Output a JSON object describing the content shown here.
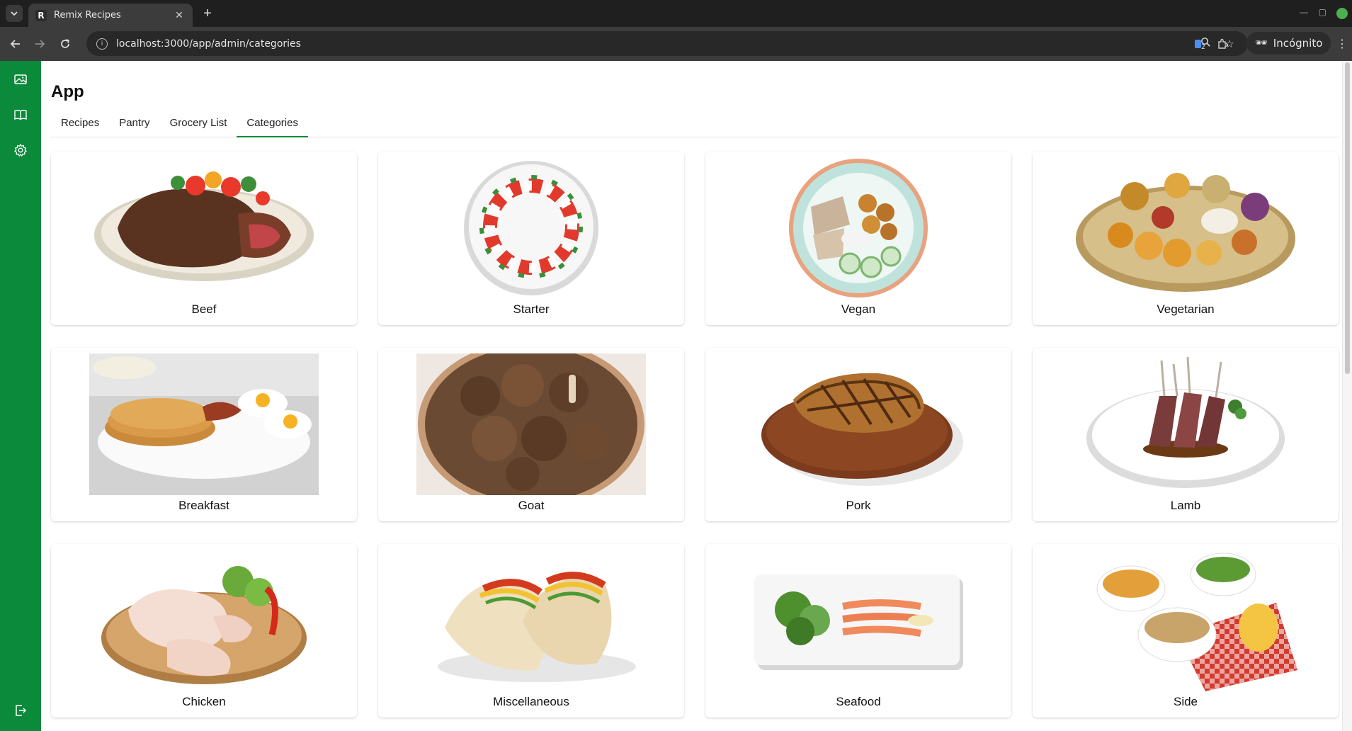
{
  "browser": {
    "tab_title": "Remix Recipes",
    "favicon_letter": "R",
    "new_tab_label": "+",
    "url": "localhost:3000/app/admin/categories",
    "profile_label": "Incógnito"
  },
  "app": {
    "title": "App",
    "accent_color": "#0a8a3a",
    "tabs": [
      {
        "label": "Recipes"
      },
      {
        "label": "Pantry"
      },
      {
        "label": "Grocery List"
      },
      {
        "label": "Categories"
      }
    ],
    "active_tab": "Categories",
    "sidebar": [
      {
        "icon": "image-icon"
      },
      {
        "icon": "book-icon"
      },
      {
        "icon": "settings-icon"
      },
      {
        "icon": "logout-icon"
      }
    ]
  },
  "categories": [
    {
      "label": "Beef"
    },
    {
      "label": "Starter"
    },
    {
      "label": "Vegan"
    },
    {
      "label": "Vegetarian"
    },
    {
      "label": "Breakfast"
    },
    {
      "label": "Goat"
    },
    {
      "label": "Pork"
    },
    {
      "label": "Lamb"
    },
    {
      "label": "Chicken"
    },
    {
      "label": "Miscellaneous"
    },
    {
      "label": "Seafood"
    },
    {
      "label": "Side"
    }
  ]
}
